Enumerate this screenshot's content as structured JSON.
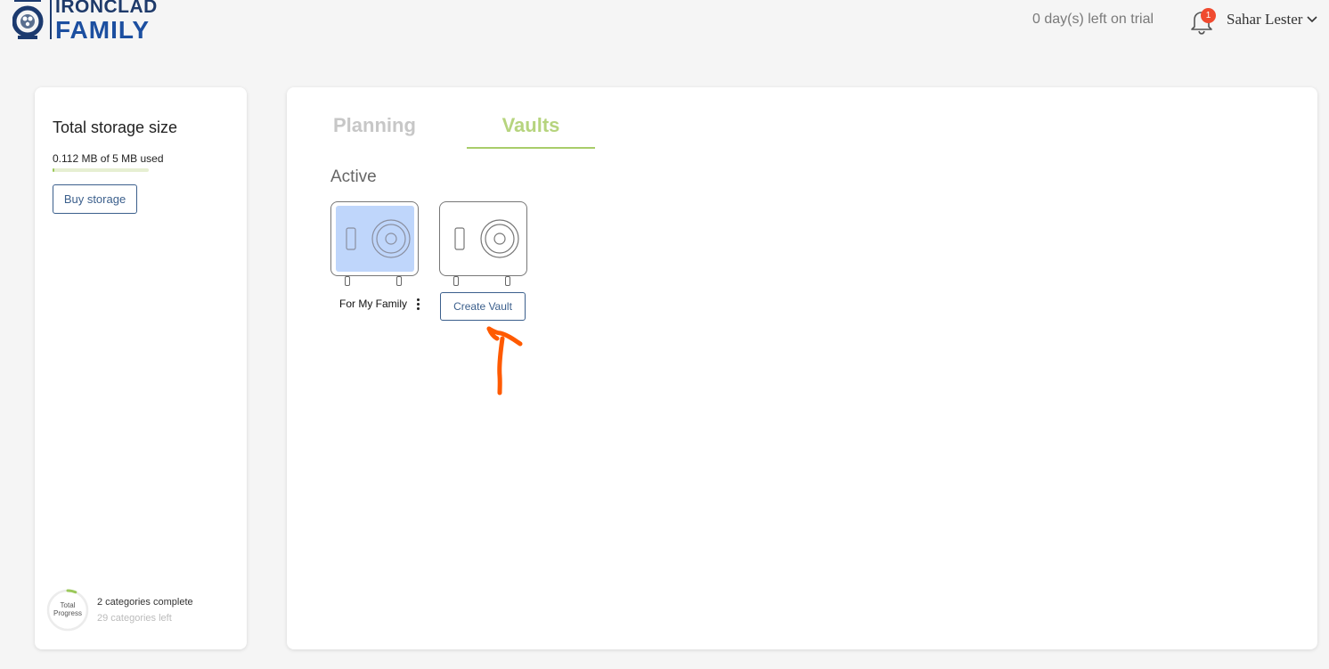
{
  "header": {
    "logo_top": "IRONCLAD",
    "logo_bottom": "FAMILY",
    "trial_text": "0 day(s) left on trial",
    "notification_count": "1",
    "user_name": "Sahar Lester"
  },
  "sidebar": {
    "storage_title": "Total storage size",
    "storage_used": "0.112 MB of 5 MB used",
    "storage_fraction": 0.0224,
    "buy_storage_label": "Buy storage",
    "progress_ring_line1": "Total",
    "progress_ring_line2": "Progress",
    "categories_complete": "2 categories complete",
    "categories_left": "29 categories left",
    "progress_fraction": 0.065
  },
  "main": {
    "tabs": [
      {
        "label": "Planning",
        "active": false
      },
      {
        "label": "Vaults",
        "active": true
      }
    ],
    "section_label": "Active",
    "vaults": [
      {
        "name": "For My Family",
        "highlighted": true
      }
    ],
    "create_vault_label": "Create Vault"
  },
  "colors": {
    "accent_green": "#a8cd6a",
    "brand_blue": "#1c4fa0",
    "button_border": "#3b5f8c",
    "annotation_orange": "#ff5a00",
    "vault_highlight": "#bfd6fb",
    "badge_red": "#f04a2f"
  },
  "icons": {
    "logo": "ironclad-family-logo-icon",
    "bell": "bell-icon",
    "user_menu": "chevron-down-icon",
    "vault": "safe-icon",
    "more": "kebab-menu-icon",
    "annotation": "arrow-up-annotation-icon"
  }
}
